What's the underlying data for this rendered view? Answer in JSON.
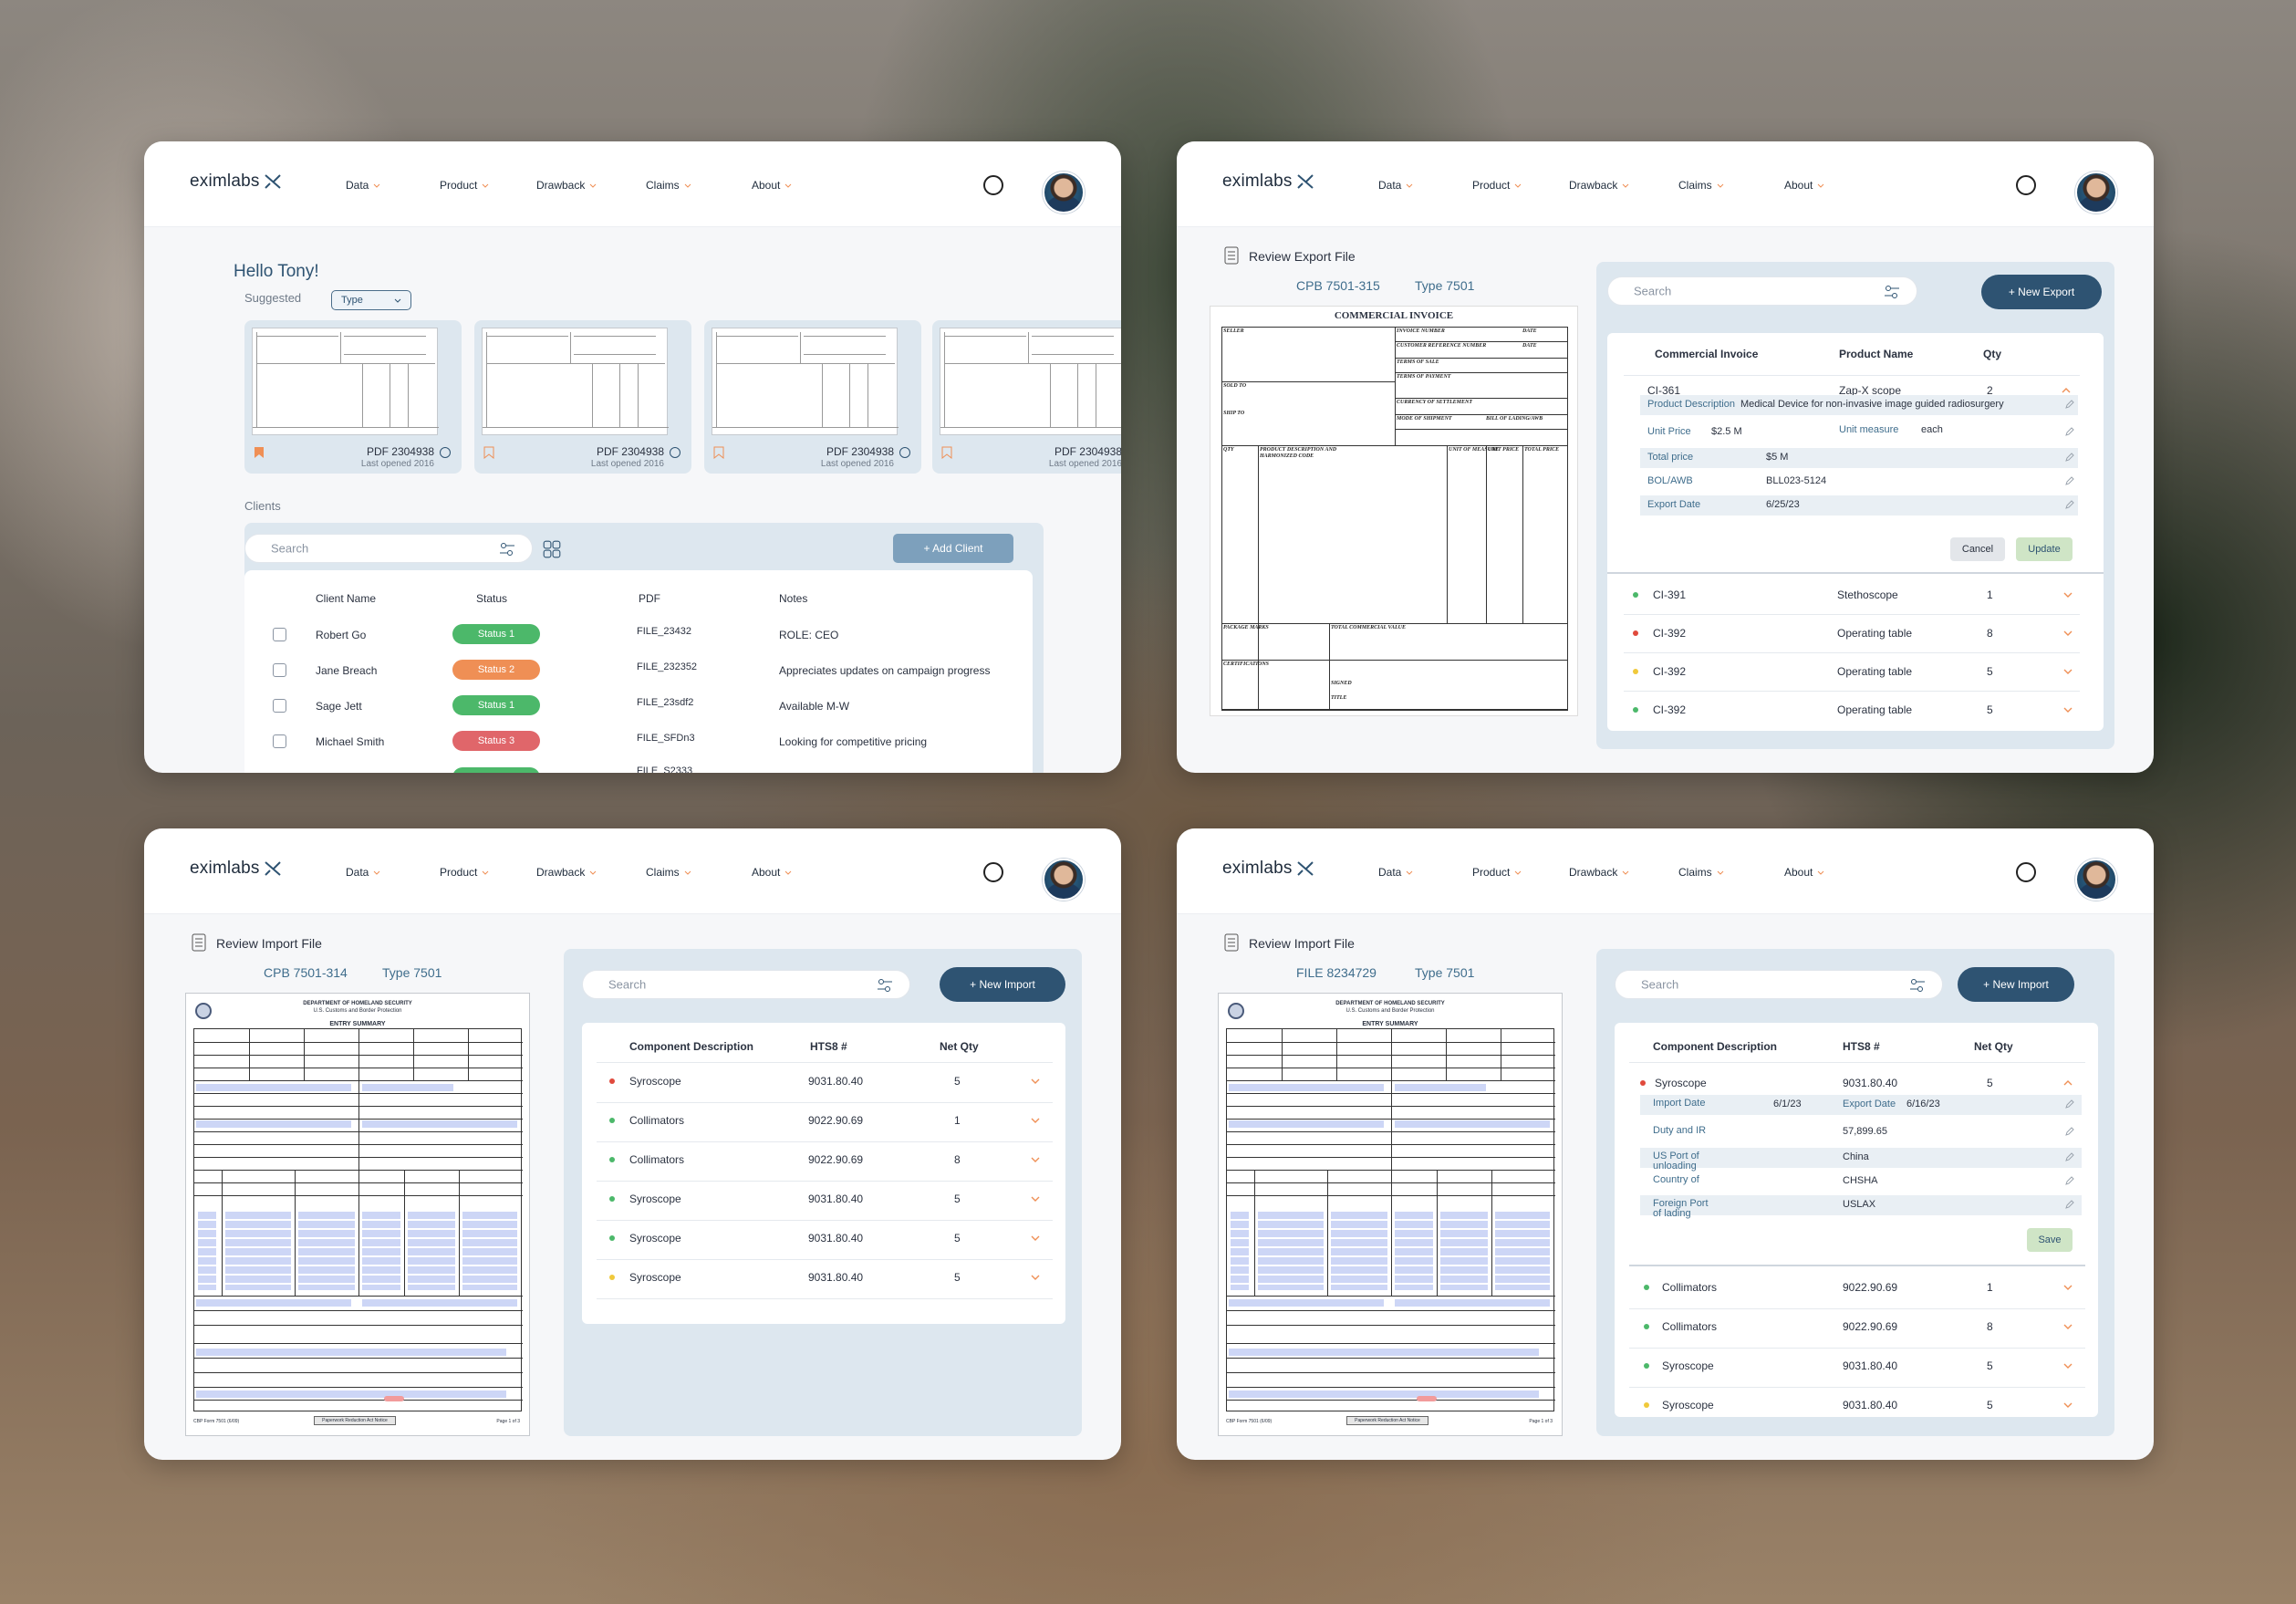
{
  "brand": {
    "logo_text": "eximlabs"
  },
  "nav": {
    "items": [
      "Data",
      "Product",
      "Drawback",
      "Claims",
      "About"
    ]
  },
  "colors": {
    "accent": "#2e5372",
    "status_green": "#4cb86a",
    "status_orange": "#ef8f55",
    "status_red": "#e0666a"
  },
  "dashboard": {
    "greeting": "Hello Tony!",
    "suggested_label": "Suggested",
    "type_filter": "Type",
    "cards": [
      {
        "title": "PDF 2304938",
        "sub": "Last opened 2016"
      },
      {
        "title": "PDF 2304938",
        "sub": "Last opened 2016"
      },
      {
        "title": "PDF 2304938",
        "sub": "Last opened 2016"
      },
      {
        "title": "PDF 2304938",
        "sub": "Last opened 2016"
      }
    ],
    "clients_label": "Clients",
    "search_placeholder": "Search",
    "add_client": "+ Add Client",
    "columns": [
      "Client Name",
      "Status",
      "PDF",
      "Notes"
    ],
    "rows": [
      {
        "name": "Robert Go",
        "status": "Status 1",
        "pdf": "FILE_23432",
        "notes": "ROLE: CEO"
      },
      {
        "name": "Jane Breach",
        "status": "Status 2",
        "pdf": "FILE_232352",
        "notes": "Appreciates updates on campaign progress"
      },
      {
        "name": "Sage Jett",
        "status": "Status 1",
        "pdf": "FILE_23sdf2",
        "notes": "Available M-W"
      },
      {
        "name": "Michael Smith",
        "status": "Status 3",
        "pdf": "FILE_SFDn3",
        "notes": "Looking for competitive pricing"
      }
    ],
    "partial_row_pdf": "FILE_S2333"
  },
  "export": {
    "title": "Review Export File",
    "file_id": "CPB 7501-315",
    "file_type": "Type 7501",
    "search_placeholder": "Search",
    "new_btn": "+ New Export",
    "doc_title": "COMMERCIAL INVOICE",
    "doc_labels": [
      "SELLER",
      "INVOICE NUMBER",
      "DATE",
      "CUSTOMER REFERENCE NUMBER",
      "DATE",
      "TERMS OF SALE",
      "SOLD TO",
      "TERMS OF PAYMENT",
      "SHIP TO",
      "CURRENCY OF SETTLEMENT",
      "MODE OF SHIPMENT",
      "BILL OF LADING/AWB",
      "QTY",
      "PRODUCT DESCRIPTION AND HARMONIZED CODE",
      "UNIT OF MEASURE",
      "UNIT PRICE",
      "TOTAL PRICE",
      "PACKAGE MARKS",
      "TOTAL COMMERCIAL VALUE",
      "CERTIFICATIONS",
      "SIGNED",
      "TITLE"
    ],
    "columns": [
      "Commercial Invoice",
      "Product Name",
      "Qty"
    ],
    "expanded": {
      "id": "CI-361",
      "name": "Zap-X scope",
      "qty": "2",
      "product_description_label": "Product Description",
      "product_description": "Medical Device for non-invasive image guided radiosurgery",
      "unit_price_label": "Unit Price",
      "unit_price": "$2.5 M",
      "unit_measure_label": "Unit measure",
      "unit_measure": "each",
      "total_price_label": "Total price",
      "total_price": "$5 M",
      "bol_label": "BOL/AWB",
      "bol": "BLL023-5124",
      "export_date_label": "Export Date",
      "export_date": "6/25/23",
      "cancel": "Cancel",
      "update": "Update"
    },
    "rows": [
      {
        "id": "CI-391",
        "name": "Stethoscope",
        "qty": "1",
        "status": "green"
      },
      {
        "id": "CI-392",
        "name": "Operating table",
        "qty": "8",
        "status": "red"
      },
      {
        "id": "CI-392",
        "name": "Operating table",
        "qty": "5",
        "status": "yellow"
      },
      {
        "id": "CI-392",
        "name": "Operating table",
        "qty": "5",
        "status": "green"
      }
    ]
  },
  "import1": {
    "title": "Review Import File",
    "file_id": "CPB 7501-314",
    "file_type": "Type 7501",
    "search_placeholder": "Search",
    "new_btn": "+ New Import",
    "columns": [
      "Component Description",
      "HTS8 #",
      "Net Qty"
    ],
    "rows": [
      {
        "desc": "Syroscope",
        "hts": "9031.80.40",
        "qty": "5",
        "status": "red"
      },
      {
        "desc": "Collimators",
        "hts": "9022.90.69",
        "qty": "1",
        "status": "green"
      },
      {
        "desc": "Collimators",
        "hts": "9022.90.69",
        "qty": "8",
        "status": "green"
      },
      {
        "desc": "Syroscope",
        "hts": "9031.80.40",
        "qty": "5",
        "status": "green"
      },
      {
        "desc": "Syroscope",
        "hts": "9031.80.40",
        "qty": "5",
        "status": "green"
      },
      {
        "desc": "Syroscope",
        "hts": "9031.80.40",
        "qty": "5",
        "status": "yellow"
      }
    ]
  },
  "import2": {
    "title": "Review Import File",
    "file_id": "FILE 8234729",
    "file_type": "Type 7501",
    "search_placeholder": "Search",
    "new_btn": "+ New Import",
    "columns": [
      "Component Description",
      "HTS8 #",
      "Net Qty"
    ],
    "expanded": {
      "desc": "Syroscope",
      "hts": "9031.80.40",
      "qty": "5",
      "import_date_label": "Import Date",
      "import_date": "6/1/23",
      "export_date_label": "Export Date",
      "export_date": "6/16/23",
      "duty_label": "Duty and IR",
      "duty": "57,899.65",
      "us_port_label": "US Port of unloading",
      "us_port": "China",
      "country_label": "Country of",
      "country": "CHSHA",
      "foreign_port_label": "Foreign Port of lading",
      "foreign_port": "USLAX",
      "save": "Save"
    },
    "rows": [
      {
        "desc": "Collimators",
        "hts": "9022.90.69",
        "qty": "1",
        "status": "green"
      },
      {
        "desc": "Collimators",
        "hts": "9022.90.69",
        "qty": "8",
        "status": "green"
      },
      {
        "desc": "Syroscope",
        "hts": "9031.80.40",
        "qty": "5",
        "status": "green"
      },
      {
        "desc": "Syroscope",
        "hts": "9031.80.40",
        "qty": "5",
        "status": "yellow"
      }
    ]
  },
  "form7501": {
    "header_line1": "DEPARTMENT OF HOMELAND SECURITY",
    "header_line2": "U.S. Customs and Border Protection",
    "title": "ENTRY SUMMARY",
    "footer_left": "CBP Form 7501 (6/09)",
    "footer_center": "Paperwork Reduction Act Notice",
    "footer_right": "Page 1 of 3"
  }
}
